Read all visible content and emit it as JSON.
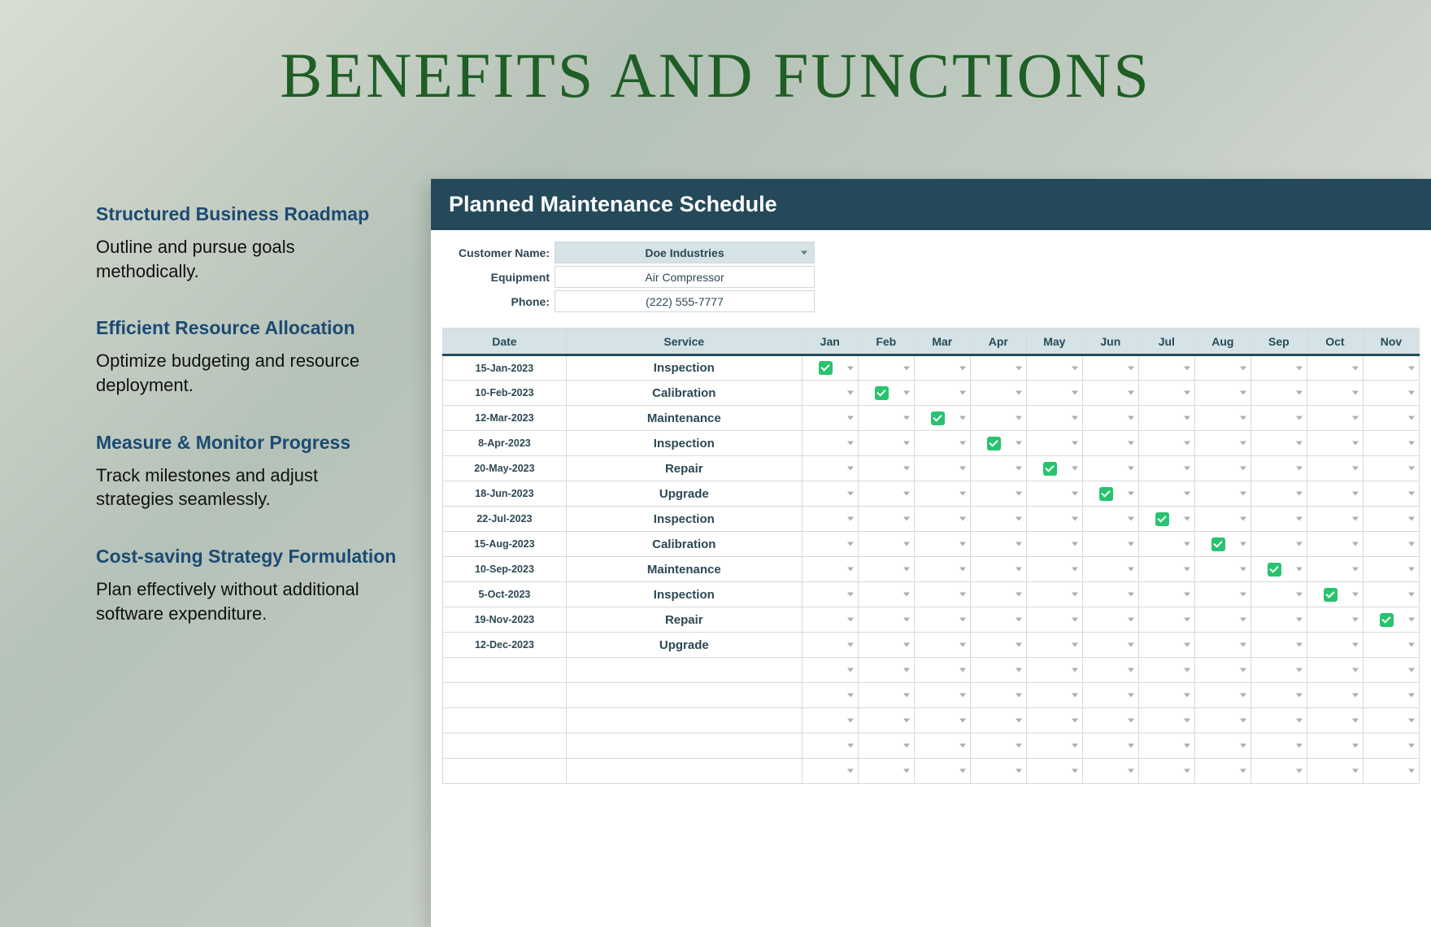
{
  "title": "Benefits and Functions",
  "benefits": [
    {
      "title": "Structured Business Roadmap",
      "desc": "Outline and pursue goals methodically."
    },
    {
      "title": "Efficient Resource Allocation",
      "desc": "Optimize budgeting and resource deployment."
    },
    {
      "title": "Measure & Monitor Progress",
      "desc": "Track milestones and adjust strategies seamlessly."
    },
    {
      "title": "Cost-saving Strategy Formulation",
      "desc": "Plan effectively without additional software expenditure."
    }
  ],
  "sheet": {
    "header": "Planned Maintenance Schedule",
    "info": {
      "customer_label": "Customer Name:",
      "customer_value": "Doe Industries",
      "equipment_label": "Equipment",
      "equipment_value": "Air Compressor",
      "phone_label": "Phone:",
      "phone_value": "(222) 555-7777"
    },
    "columns": [
      "Date",
      "Service",
      "Jan",
      "Feb",
      "Mar",
      "Apr",
      "May",
      "Jun",
      "Jul",
      "Aug",
      "Sep",
      "Oct",
      "Nov"
    ],
    "rows": [
      {
        "date": "15-Jan-2023",
        "service": "Inspection",
        "checked": 0
      },
      {
        "date": "10-Feb-2023",
        "service": "Calibration",
        "checked": 1
      },
      {
        "date": "12-Mar-2023",
        "service": "Maintenance",
        "checked": 2
      },
      {
        "date": "8-Apr-2023",
        "service": "Inspection",
        "checked": 3
      },
      {
        "date": "20-May-2023",
        "service": "Repair",
        "checked": 4
      },
      {
        "date": "18-Jun-2023",
        "service": "Upgrade",
        "checked": 5
      },
      {
        "date": "22-Jul-2023",
        "service": "Inspection",
        "checked": 6
      },
      {
        "date": "15-Aug-2023",
        "service": "Calibration",
        "checked": 7
      },
      {
        "date": "10-Sep-2023",
        "service": "Maintenance",
        "checked": 8
      },
      {
        "date": "5-Oct-2023",
        "service": "Inspection",
        "checked": 9
      },
      {
        "date": "19-Nov-2023",
        "service": "Repair",
        "checked": 10
      },
      {
        "date": "12-Dec-2023",
        "service": "Upgrade",
        "checked": -1
      },
      {
        "date": "",
        "service": "",
        "checked": -1
      },
      {
        "date": "",
        "service": "",
        "checked": -1
      },
      {
        "date": "",
        "service": "",
        "checked": -1
      },
      {
        "date": "",
        "service": "",
        "checked": -1
      },
      {
        "date": "",
        "service": "",
        "checked": -1
      }
    ]
  }
}
